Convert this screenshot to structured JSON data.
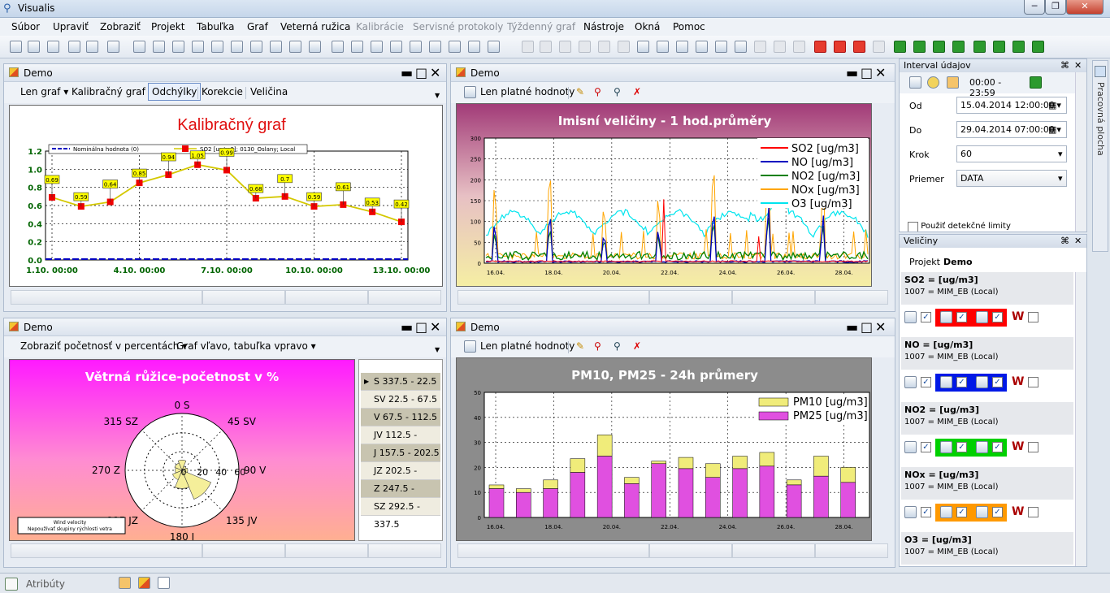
{
  "app": {
    "title": "Visualis"
  },
  "menu": [
    "Súbor",
    "Upraviť",
    "Zobraziť",
    "Projekt",
    "Tabuľka",
    "Graf",
    "Veterná ružica",
    "Kalibrácie",
    "Servisné protokoly",
    "Týždenný graf",
    "Nástroje",
    "Okná",
    "Pomoc"
  ],
  "menu_disabled": [
    "Kalibrácie",
    "Servisné protokoly",
    "Týždenný graf"
  ],
  "panels": {
    "tl": {
      "name": "Demo",
      "tabs": [
        "Len graf",
        "Kalibračný graf",
        "Odchýlky",
        "Korekcie",
        "Veličina"
      ]
    },
    "tr": {
      "name": "Demo",
      "tool": "Len platné hodnoty"
    },
    "bl": {
      "name": "Demo",
      "tabs": [
        "Zobraziť početnosť v percentách",
        "Graf vľavo, tabuľka vpravo"
      ]
    },
    "br": {
      "name": "Demo",
      "tool": "Len platné hodnoty"
    }
  },
  "interval": {
    "title": "Interval údajov",
    "time": "00:00 - 23:59",
    "od_label": "Od",
    "od": "15.04.2014 12:00:00",
    "do_label": "Do",
    "do": "29.04.2014 07:00:00",
    "krok_label": "Krok",
    "krok": "60",
    "priemer_label": "Priemer",
    "priemer": "DATA",
    "detect": "Použiť detekčné limity"
  },
  "velicina": {
    "title": "Veličiny",
    "projekt_label": "Projekt",
    "projekt": "Demo",
    "items": [
      {
        "name": "SO2 =  [ug/m3]",
        "station": "1007 = MIM_EB  (Local)",
        "color": "#ff0000"
      },
      {
        "name": "NO =  [ug/m3]",
        "station": "1007 = MIM_EB  (Local)",
        "color": "#0019e6"
      },
      {
        "name": "NO2 =  [ug/m3]",
        "station": "1007 = MIM_EB  (Local)",
        "color": "#00d000"
      },
      {
        "name": "NOx =  [ug/m3]",
        "station": "1007 = MIM_EB  (Local)",
        "color": "#ff9900"
      },
      {
        "name": "O3 =  [ug/m3]",
        "station": "1007 = MIM_EB  (Local)",
        "color": "#00e8f0"
      }
    ]
  },
  "side_tab": "Pracovná plocha",
  "status": {
    "atributy": "Atribúty"
  },
  "rose_table": [
    "S 337.5 - 22.5",
    "SV 22.5 - 67.5",
    "V 67.5 - 112.5",
    "JV 112.5 - 157.5",
    "J 157.5 - 202.5",
    "JZ 202.5 - 247.5",
    "Z 247.5 - 292.5",
    "SZ 292.5 - 337.5"
  ],
  "chart_data": [
    {
      "type": "line",
      "title": "Kalibračný graf",
      "categories_ticks": [
        "1.10. 00:00",
        "4.10. 00:00",
        "7.10. 00:00",
        "10.10. 00:00",
        "13.10. 00:00"
      ],
      "yticks": [
        "0.0",
        "0.2",
        "0.4",
        "0.6",
        "0.8",
        "1.0",
        "1.2"
      ],
      "ylim": [
        0,
        1.2
      ],
      "legend": [
        "Nominálna hodnota (0)",
        "SO2 [ug/m3]; 0130_Oslany; Local"
      ],
      "series": [
        {
          "name": "SO2 [ug/m3]; 0130_Oslany; Local",
          "values": [
            0.69,
            0.59,
            0.64,
            0.85,
            0.94,
            1.05,
            0.99,
            0.68,
            0.7,
            0.59,
            0.61,
            0.53,
            0.42
          ]
        },
        {
          "name": "Nominálna hodnota (0)",
          "values": [
            0,
            0,
            0,
            0,
            0,
            0,
            0,
            0,
            0,
            0,
            0,
            0,
            0
          ]
        }
      ]
    },
    {
      "type": "line",
      "title": "Imisní veličiny - 1 hod.průměry",
      "ylim": [
        0,
        300
      ],
      "yticks": [
        "0",
        "50",
        "100",
        "150",
        "200",
        "250",
        "300"
      ],
      "xticks": [
        "16.04.",
        "18.04.",
        "20.04.",
        "22.04.",
        "24.04.",
        "26.04.",
        "28.04."
      ],
      "series": [
        {
          "name": "SO2 [ug/m3]",
          "color": "#ff0000"
        },
        {
          "name": "NO [ug/m3]",
          "color": "#0000c0"
        },
        {
          "name": "NO2 [ug/m3]",
          "color": "#008000"
        },
        {
          "name": "NOx [ug/m3]",
          "color": "#ffa500"
        },
        {
          "name": "O3 [ug/m3]",
          "color": "#00e5ee"
        }
      ]
    },
    {
      "type": "bar",
      "title": "PM10, PM25 - 24h průmery",
      "ylim": [
        0,
        50
      ],
      "yticks": [
        "0",
        "10",
        "20",
        "30",
        "40",
        "50"
      ],
      "xticks": [
        "16.04.",
        "18.04.",
        "20.04.",
        "22.04.",
        "24.04.",
        "26.04.",
        "28.04."
      ],
      "series": [
        {
          "name": "PM10 [ug/m3]",
          "values": [
            13,
            11.5,
            15,
            23.5,
            33,
            16,
            22.5,
            24,
            21.5,
            24.5,
            26,
            15,
            24.5,
            20
          ]
        },
        {
          "name": "PM25 [ug/m3]",
          "values": [
            11.5,
            10,
            11.5,
            18,
            24.5,
            13.5,
            21.5,
            19.5,
            16,
            19.5,
            20.5,
            13,
            16.5,
            14
          ]
        }
      ]
    },
    {
      "type": "pie",
      "title": "Větrná růžice-početnost v %",
      "directions": [
        "0 S",
        "45 SV",
        "90 V",
        "135 JV",
        "180 J",
        "225 JZ",
        "270 Z",
        "315 SZ"
      ],
      "rings": [
        "0",
        "20",
        "40",
        "60"
      ],
      "legend": [
        "Wind velocity",
        "Nepoužívať skupiny rýchlosti vetra"
      ]
    }
  ]
}
